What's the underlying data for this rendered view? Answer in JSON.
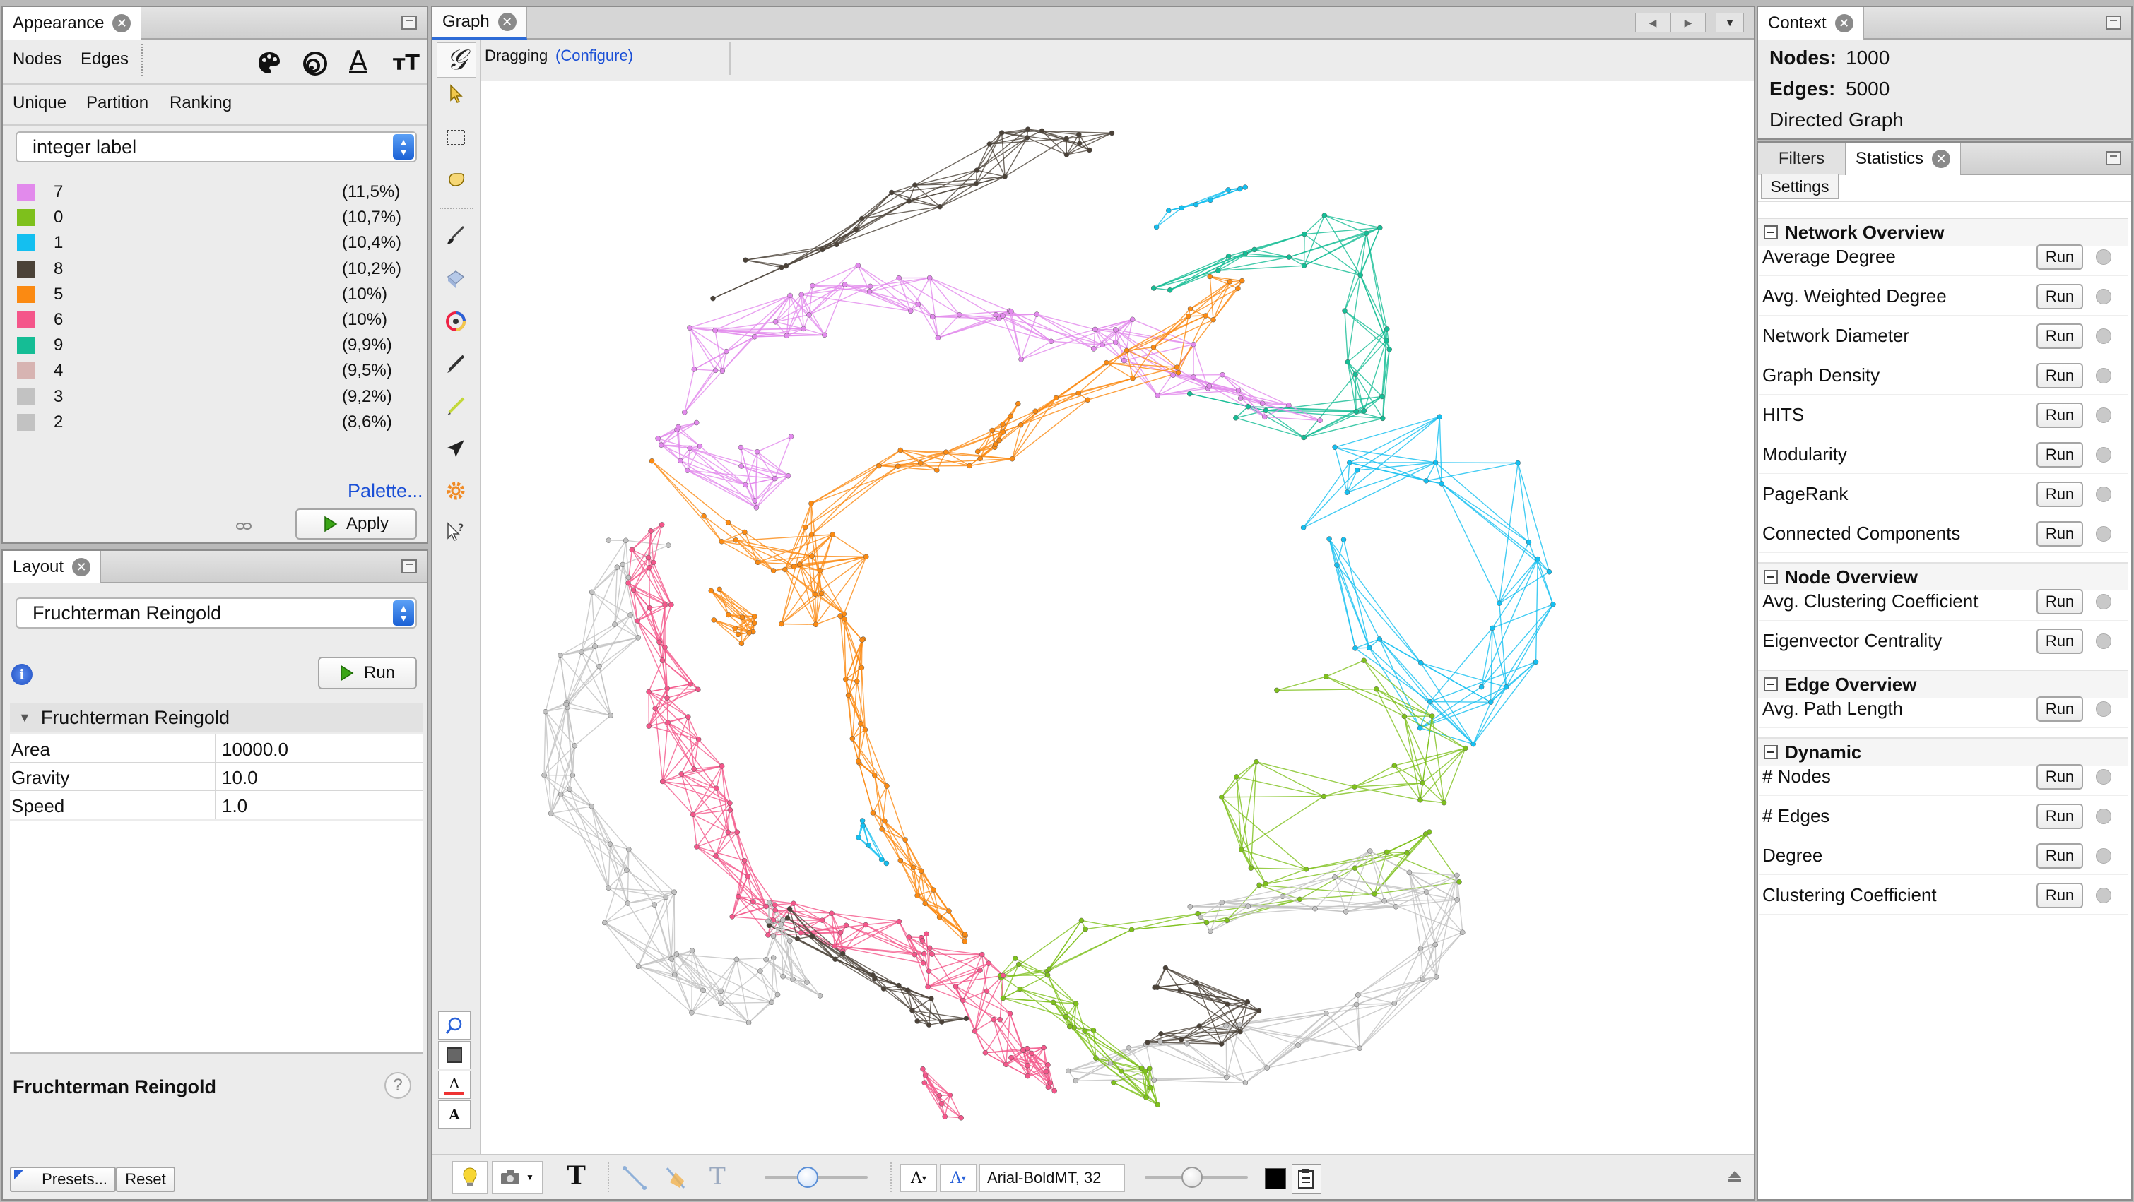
{
  "appearance": {
    "tab_label": "Appearance",
    "element_tabs": [
      "Nodes",
      "Edges"
    ],
    "mode_tabs": [
      "Unique",
      "Partition",
      "Ranking"
    ],
    "attribute_select": "integer label",
    "partitions": [
      {
        "label": "7",
        "percent": "(11,5%)",
        "color": "#e28aec"
      },
      {
        "label": "0",
        "percent": "(10,7%)",
        "color": "#7ec01c"
      },
      {
        "label": "1",
        "percent": "(10,4%)",
        "color": "#14bff0"
      },
      {
        "label": "8",
        "percent": "(10,2%)",
        "color": "#4b4238"
      },
      {
        "label": "5",
        "percent": "(10%)",
        "color": "#fb8a12"
      },
      {
        "label": "6",
        "percent": "(10%)",
        "color": "#f4568a"
      },
      {
        "label": "9",
        "percent": "(9,9%)",
        "color": "#15bd95"
      },
      {
        "label": "4",
        "percent": "(9,5%)",
        "color": "#d7b4b2"
      },
      {
        "label": "3",
        "percent": "(9,2%)",
        "color": "#c2c2c2"
      },
      {
        "label": "2",
        "percent": "(8,6%)",
        "color": "#c2c2c2"
      }
    ],
    "palette_link": "Palette...",
    "apply_label": "Apply"
  },
  "layout": {
    "tab_label": "Layout",
    "algorithm_select": "Fruchterman Reingold",
    "run_label": "Run",
    "section_title": "Fruchterman Reingold",
    "properties": [
      {
        "name": "Area",
        "value": "10000.0"
      },
      {
        "name": "Gravity",
        "value": "10.0"
      },
      {
        "name": "Speed",
        "value": "1.0"
      }
    ],
    "description_title": "Fruchterman Reingold",
    "help_label": "?",
    "presets_label": "Presets...",
    "reset_label": "Reset"
  },
  "graph": {
    "tab_label": "Graph",
    "mode_text": "Dragging",
    "configure_link": "(Configure)",
    "font_label": "Arial-BoldMT, 32"
  },
  "context": {
    "tab_label": "Context",
    "nodes_label": "Nodes:",
    "nodes_value": "1000",
    "edges_label": "Edges:",
    "edges_value": "5000",
    "graph_type": "Directed Graph"
  },
  "statistics": {
    "tabs": [
      "Filters",
      "Statistics"
    ],
    "settings_label": "Settings",
    "run_label": "Run",
    "sections": [
      {
        "title": "Network Overview",
        "items": [
          "Average Degree",
          "Avg. Weighted Degree",
          "Network Diameter",
          "Graph Density",
          "HITS",
          "Modularity",
          "PageRank",
          "Connected Components"
        ]
      },
      {
        "title": "Node Overview",
        "items": [
          "Avg. Clustering Coefficient",
          "Eigenvector Centrality"
        ]
      },
      {
        "title": "Edge Overview",
        "items": [
          "Avg. Path Length"
        ]
      },
      {
        "title": "Dynamic",
        "items": [
          "# Nodes",
          "# Edges",
          "Degree",
          "Clustering Coefficient"
        ]
      }
    ]
  },
  "network": {
    "clusters": [
      {
        "color": "#4b4238",
        "nodes": 26,
        "path": [
          [
            1045,
            395
          ],
          [
            1120,
            360
          ],
          [
            1200,
            320
          ],
          [
            1280,
            280
          ],
          [
            1360,
            240
          ],
          [
            1420,
            205
          ],
          [
            1470,
            190
          ],
          [
            1520,
            200
          ],
          [
            1550,
            220
          ]
        ],
        "spread": 38
      },
      {
        "color": "#14bff0",
        "nodes": 8,
        "path": [
          [
            1630,
            310
          ],
          [
            1680,
            295
          ],
          [
            1730,
            275
          ],
          [
            1750,
            260
          ]
        ],
        "spread": 14
      },
      {
        "color": "#15bd95",
        "nodes": 28,
        "path": [
          [
            1620,
            405
          ],
          [
            1680,
            390
          ],
          [
            1740,
            370
          ],
          [
            1800,
            355
          ],
          [
            1860,
            340
          ],
          [
            1900,
            330
          ],
          [
            1920,
            345
          ],
          [
            1930,
            400
          ],
          [
            1930,
            450
          ],
          [
            1940,
            500
          ],
          [
            1950,
            560
          ],
          [
            1940,
            590
          ],
          [
            1900,
            600
          ],
          [
            1840,
            590
          ],
          [
            1780,
            560
          ],
          [
            1720,
            530
          ]
        ],
        "spread": 40
      },
      {
        "color": "#14bff0",
        "nodes": 30,
        "path": [
          [
            1880,
            700
          ],
          [
            1910,
            660
          ],
          [
            1960,
            640
          ],
          [
            2020,
            630
          ],
          [
            2070,
            640
          ],
          [
            2100,
            700
          ],
          [
            2130,
            760
          ],
          [
            2150,
            820
          ],
          [
            2150,
            880
          ],
          [
            2120,
            940
          ],
          [
            2100,
            990
          ],
          [
            2060,
            1010
          ],
          [
            2000,
            1000
          ],
          [
            1940,
            950
          ],
          [
            1910,
            900
          ],
          [
            1890,
            820
          ],
          [
            1880,
            760
          ]
        ],
        "spread": 60
      },
      {
        "color": "#7ec01c",
        "nodes": 38,
        "path": [
          [
            1800,
            975
          ],
          [
            1880,
            960
          ],
          [
            1960,
            970
          ],
          [
            2030,
            1010
          ],
          [
            2060,
            1060
          ],
          [
            2040,
            1100
          ],
          [
            1980,
            1120
          ],
          [
            1920,
            1110
          ],
          [
            1860,
            1100
          ],
          [
            1800,
            1100
          ],
          [
            1760,
            1150
          ],
          [
            1760,
            1210
          ],
          [
            1800,
            1240
          ],
          [
            1880,
            1230
          ],
          [
            1960,
            1190
          ],
          [
            2040,
            1180
          ],
          [
            2060,
            1210
          ],
          [
            1960,
            1240
          ],
          [
            1880,
            1260
          ],
          [
            1800,
            1280
          ],
          [
            1720,
            1300
          ],
          [
            1650,
            1320
          ],
          [
            1580,
            1330
          ],
          [
            1540,
            1340
          ],
          [
            1480,
            1350
          ],
          [
            1420,
            1360
          ]
        ],
        "spread": 40
      },
      {
        "color": "#c2c2c2",
        "nodes": 40,
        "path": [
          [
            1660,
            1290
          ],
          [
            1700,
            1290
          ],
          [
            1760,
            1260
          ],
          [
            1840,
            1250
          ],
          [
            1900,
            1240
          ],
          [
            1960,
            1240
          ],
          [
            2000,
            1240
          ],
          [
            2030,
            1260
          ],
          [
            2020,
            1300
          ],
          [
            2000,
            1360
          ],
          [
            1960,
            1420
          ],
          [
            1920,
            1440
          ],
          [
            1860,
            1460
          ],
          [
            1820,
            1470
          ],
          [
            1770,
            1490
          ],
          [
            1720,
            1500
          ],
          [
            1660,
            1510
          ],
          [
            1600,
            1520
          ],
          [
            1540,
            1510
          ],
          [
            1500,
            1490
          ]
        ],
        "spread": 55
      },
      {
        "color": "#4b4238",
        "nodes": 14,
        "path": [
          [
            1620,
            1385
          ],
          [
            1660,
            1390
          ],
          [
            1700,
            1400
          ],
          [
            1740,
            1420
          ],
          [
            1760,
            1460
          ],
          [
            1700,
            1470
          ],
          [
            1640,
            1470
          ],
          [
            1600,
            1460
          ]
        ],
        "spread": 30
      },
      {
        "color": "#7ec01c",
        "nodes": 22,
        "path": [
          [
            1400,
            1360
          ],
          [
            1440,
            1390
          ],
          [
            1480,
            1420
          ],
          [
            1520,
            1450
          ],
          [
            1560,
            1480
          ],
          [
            1600,
            1510
          ],
          [
            1620,
            1540
          ],
          [
            1600,
            1520
          ]
        ],
        "spread": 30
      },
      {
        "color": "#f4568a",
        "nodes": 34,
        "path": [
          [
            1290,
            1330
          ],
          [
            1330,
            1360
          ],
          [
            1360,
            1380
          ],
          [
            1380,
            1400
          ],
          [
            1400,
            1440
          ],
          [
            1420,
            1480
          ],
          [
            1440,
            1500
          ],
          [
            1460,
            1510
          ],
          [
            1480,
            1520
          ]
        ],
        "spread": 40
      },
      {
        "color": "#c2c2c2",
        "nodes": 50,
        "path": [
          [
            900,
            740
          ],
          [
            880,
            800
          ],
          [
            860,
            860
          ],
          [
            840,
            920
          ],
          [
            820,
            980
          ],
          [
            810,
            1040
          ],
          [
            820,
            1100
          ],
          [
            840,
            1160
          ],
          [
            860,
            1220
          ],
          [
            880,
            1280
          ],
          [
            910,
            1340
          ],
          [
            950,
            1380
          ],
          [
            990,
            1400
          ],
          [
            1040,
            1400
          ],
          [
            1100,
            1400
          ]
        ],
        "spread": 60
      },
      {
        "color": "#f4568a",
        "nodes": 60,
        "path": [
          [
            890,
            740
          ],
          [
            920,
            800
          ],
          [
            930,
            860
          ],
          [
            940,
            920
          ],
          [
            950,
            980
          ],
          [
            960,
            1040
          ],
          [
            980,
            1100
          ],
          [
            1000,
            1160
          ],
          [
            1030,
            1220
          ],
          [
            1060,
            1270
          ],
          [
            1100,
            1300
          ],
          [
            1160,
            1320
          ],
          [
            1220,
            1330
          ],
          [
            1290,
            1340
          ]
        ],
        "spread": 40
      },
      {
        "color": "#4b4238",
        "nodes": 18,
        "path": [
          [
            1100,
            1300
          ],
          [
            1160,
            1330
          ],
          [
            1220,
            1370
          ],
          [
            1270,
            1400
          ],
          [
            1300,
            1420
          ],
          [
            1340,
            1430
          ]
        ],
        "spread": 30
      },
      {
        "color": "#e28aec",
        "nodes": 55,
        "path": [
          [
            960,
            570
          ],
          [
            1000,
            490
          ],
          [
            1060,
            460
          ],
          [
            1120,
            440
          ],
          [
            1180,
            420
          ],
          [
            1240,
            410
          ],
          [
            1300,
            420
          ],
          [
            1360,
            440
          ],
          [
            1420,
            460
          ],
          [
            1480,
            470
          ],
          [
            1540,
            480
          ],
          [
            1600,
            500
          ],
          [
            1660,
            520
          ],
          [
            1720,
            540
          ],
          [
            1760,
            560
          ],
          [
            1820,
            580
          ]
        ],
        "spread": 50
      },
      {
        "color": "#e28aec",
        "nodes": 18,
        "path": [
          [
            960,
            570
          ],
          [
            980,
            620
          ],
          [
            1000,
            660
          ],
          [
            1040,
            690
          ],
          [
            1080,
            680
          ],
          [
            1100,
            640
          ]
        ],
        "spread": 50
      },
      {
        "color": "#fb8a12",
        "nodes": 50,
        "path": [
          [
            960,
            680
          ],
          [
            1000,
            720
          ],
          [
            1040,
            760
          ],
          [
            1080,
            800
          ],
          [
            1120,
            800
          ],
          [
            1160,
            780
          ],
          [
            1200,
            820
          ],
          [
            1180,
            860
          ],
          [
            1140,
            860
          ],
          [
            1120,
            820
          ],
          [
            1160,
            720
          ],
          [
            1220,
            680
          ],
          [
            1280,
            660
          ],
          [
            1340,
            640
          ],
          [
            1400,
            620
          ],
          [
            1460,
            600
          ],
          [
            1520,
            570
          ],
          [
            1580,
            540
          ],
          [
            1620,
            520
          ],
          [
            1660,
            490
          ],
          [
            1680,
            460
          ],
          [
            1700,
            430
          ],
          [
            1720,
            400
          ],
          [
            1760,
            380
          ]
        ],
        "spread": 40
      },
      {
        "color": "#fb8a12",
        "nodes": 12,
        "path": [
          [
            1010,
            840
          ],
          [
            1040,
            860
          ],
          [
            1060,
            880
          ],
          [
            1040,
            905
          ],
          [
            1020,
            880
          ]
        ],
        "spread": 20
      },
      {
        "color": "#fb8a12",
        "nodes": 30,
        "path": [
          [
            1200,
            860
          ],
          [
            1210,
            920
          ],
          [
            1215,
            980
          ],
          [
            1220,
            1040
          ],
          [
            1230,
            1100
          ],
          [
            1250,
            1160
          ],
          [
            1280,
            1210
          ],
          [
            1310,
            1260
          ],
          [
            1340,
            1300
          ],
          [
            1360,
            1330
          ]
        ],
        "spread": 18
      },
      {
        "color": "#fb8a12",
        "nodes": 10,
        "path": [
          [
            1380,
            640
          ],
          [
            1400,
            620
          ],
          [
            1420,
            600
          ],
          [
            1440,
            580
          ]
        ],
        "spread": 14
      },
      {
        "color": "#f4568a",
        "nodes": 8,
        "path": [
          [
            1300,
            1520
          ],
          [
            1320,
            1540
          ],
          [
            1340,
            1560
          ],
          [
            1350,
            1580
          ]
        ],
        "spread": 12
      },
      {
        "color": "#c2c2c2",
        "nodes": 12,
        "path": [
          [
            1060,
            1280
          ],
          [
            1080,
            1320
          ],
          [
            1100,
            1360
          ],
          [
            1130,
            1400
          ]
        ],
        "spread": 30
      },
      {
        "color": "#14bff0",
        "nodes": 6,
        "path": [
          [
            1220,
            1160
          ],
          [
            1230,
            1190
          ],
          [
            1240,
            1230
          ]
        ],
        "spread": 16
      }
    ]
  }
}
